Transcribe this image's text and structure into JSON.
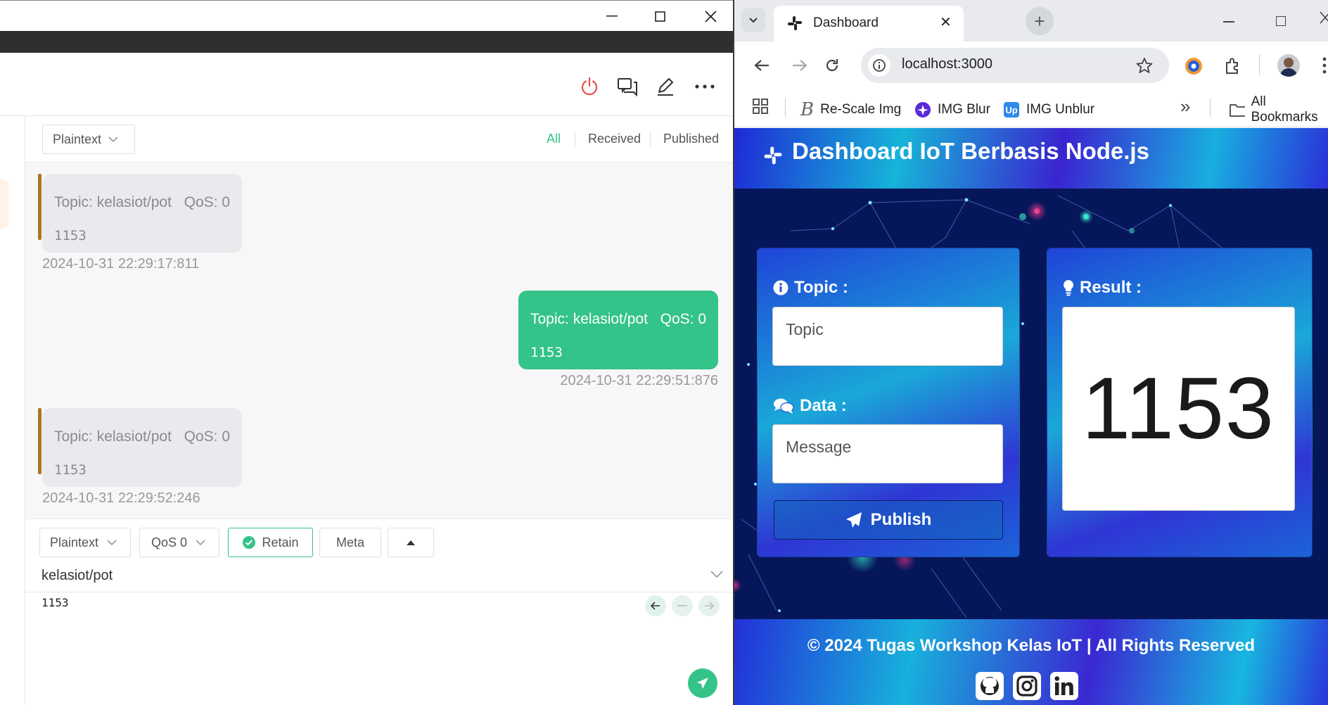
{
  "mqttx": {
    "window_controls": {
      "minimize": "—",
      "maximize": "☐",
      "close": "✕"
    },
    "format_select": "Plaintext",
    "filters": {
      "all": "All",
      "received": "Received",
      "published": "Published"
    },
    "messages": [
      {
        "direction": "received",
        "topic": "Topic: kelasiot/pot",
        "qos": "QoS: 0",
        "payload": "1153",
        "time": "2024-10-31 22:29:17:811"
      },
      {
        "direction": "published",
        "topic": "Topic: kelasiot/pot",
        "qos": "QoS: 0",
        "payload": "1153",
        "time": "2024-10-31 22:29:51:876"
      },
      {
        "direction": "received",
        "topic": "Topic: kelasiot/pot",
        "qos": "QoS: 0",
        "payload": "1153",
        "time": "2024-10-31 22:29:52:246"
      }
    ],
    "compose": {
      "format": "Plaintext",
      "qos": "QoS 0",
      "retain": "Retain",
      "meta": "Meta",
      "topic_value": "kelasiot/pot",
      "payload_value": "1153"
    },
    "colors": {
      "accent_green": "#34c388",
      "received_bar": "#a8791e",
      "disconnect": "#e5534b"
    }
  },
  "browser": {
    "tab": {
      "title": "Dashboard",
      "close": "✕",
      "new": "+"
    },
    "address": "localhost:3000",
    "bookmarks": [
      {
        "label": "Re-Scale Img"
      },
      {
        "label": "IMG Blur"
      },
      {
        "label": "IMG Unblur"
      }
    ],
    "bookmarks_overflow": "»",
    "all_bookmarks": "All Bookmarks"
  },
  "dashboard": {
    "title": "Dashboard IoT Berbasis Node.js",
    "topic_label": "Topic :",
    "topic_placeholder": "Topic",
    "data_label": "Data :",
    "data_placeholder": "Message",
    "publish": "Publish",
    "result_label": "Result :",
    "result_value": "1153",
    "footer": "© 2024 Tugas Workshop Kelas IoT | All Rights Reserved",
    "social": [
      "github-icon",
      "instagram-icon",
      "linkedin-icon"
    ]
  }
}
